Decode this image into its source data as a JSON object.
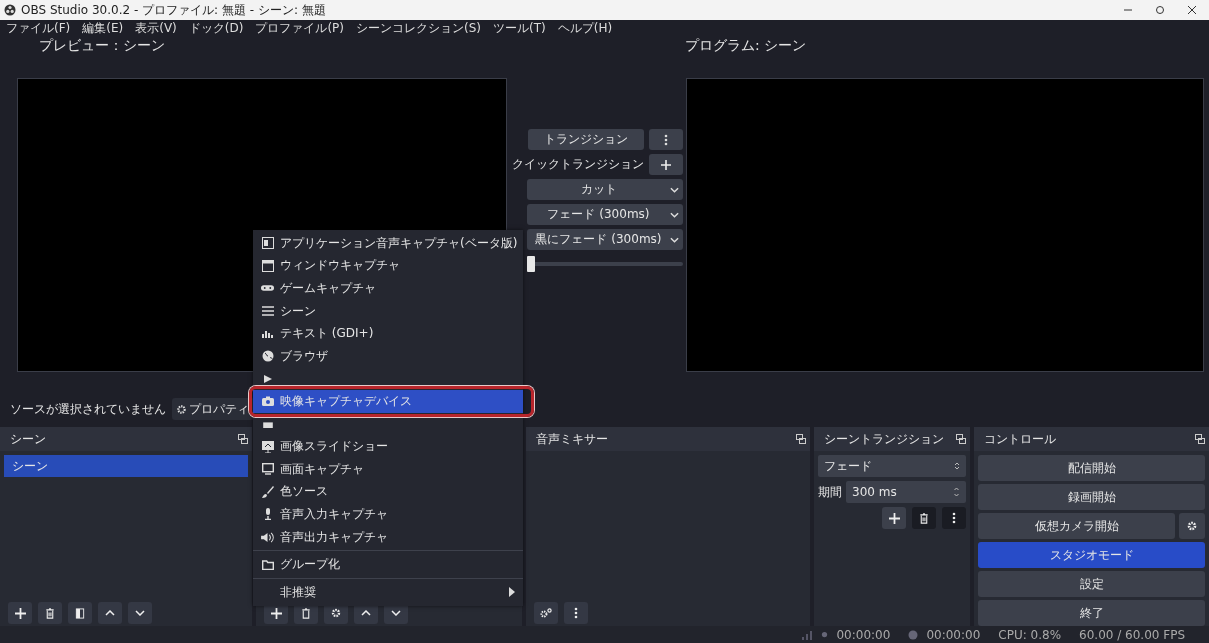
{
  "window": {
    "title": "OBS Studio 30.0.2 - プロファイル: 無題 - シーン: 無題"
  },
  "menu_bar": [
    "ファイル(F)",
    "編集(E)",
    "表示(V)",
    "ドック(D)",
    "プロファイル(P)",
    "シーンコレクション(S)",
    "ツール(T)",
    "ヘルプ(H)"
  ],
  "preview": {
    "label": "プレビュー：シーン"
  },
  "program": {
    "label": "プログラム: シーン"
  },
  "transitions": {
    "transition_button": "トランジション",
    "quick_label": "クイックトランジション",
    "quick_items": [
      {
        "label": "カット"
      },
      {
        "label": "フェード (300ms)"
      },
      {
        "label": "黒にフェード (300ms)"
      }
    ],
    "level": 0
  },
  "source_bar": {
    "status": "ソースが選択されていません",
    "properties_button": "プロパティ"
  },
  "scenes_dock": {
    "title": "シーン",
    "items": [
      {
        "label": "シーン",
        "selected": true
      }
    ]
  },
  "audio_mixer": {
    "title": "音声ミキサー"
  },
  "scene_transitions": {
    "title": "シーントランジション",
    "transition": "フェード",
    "duration_label": "期間",
    "duration": "300 ms"
  },
  "controls": {
    "title": "コントロール",
    "buttons": [
      {
        "label": "配信開始",
        "selected": false,
        "kind": "plain"
      },
      {
        "label": "録画開始",
        "selected": false,
        "kind": "plain"
      },
      {
        "label": "仮想カメラ開始",
        "selected": false,
        "kind": "settings"
      },
      {
        "label": "スタジオモード",
        "selected": true,
        "kind": "plain"
      },
      {
        "label": "設定",
        "selected": false,
        "kind": "plain"
      },
      {
        "label": "終了",
        "selected": false,
        "kind": "plain"
      }
    ]
  },
  "context_menu": {
    "items": [
      {
        "kind": "item",
        "label": "アプリケーション音声キャプチャ(ベータ版)",
        "selected": false
      },
      {
        "kind": "item",
        "label": "ウィンドウキャプチャ",
        "selected": false
      },
      {
        "kind": "item",
        "label": "ゲームキャプチャ",
        "selected": false
      },
      {
        "kind": "item",
        "label": "シーン",
        "selected": false
      },
      {
        "kind": "item",
        "label": "テキスト (GDI+)",
        "selected": false
      },
      {
        "kind": "item",
        "label": "ブラウザ",
        "selected": false
      },
      {
        "kind": "covered",
        "selected": false
      },
      {
        "kind": "item",
        "label": "映像キャプチャデバイス",
        "selected": true
      },
      {
        "kind": "covered",
        "selected": false
      },
      {
        "kind": "item",
        "label": "画像スライドショー",
        "selected": false
      },
      {
        "kind": "item",
        "label": "画面キャプチャ",
        "selected": false
      },
      {
        "kind": "item",
        "label": "色ソース",
        "selected": false
      },
      {
        "kind": "item",
        "label": "音声入力キャプチャ",
        "selected": false
      },
      {
        "kind": "item",
        "label": "音声出力キャプチャ",
        "selected": false
      },
      {
        "kind": "separator"
      },
      {
        "kind": "item",
        "label": "グループ化",
        "selected": false
      },
      {
        "kind": "separator"
      },
      {
        "kind": "submenu",
        "label": "非推奨",
        "selected": false
      }
    ]
  },
  "status_bar": {
    "stream_time": "00:00:00",
    "record_time": "00:00:00",
    "cpu": "CPU: 0.8%",
    "fps": "60.00 / 60.00 FPS"
  }
}
